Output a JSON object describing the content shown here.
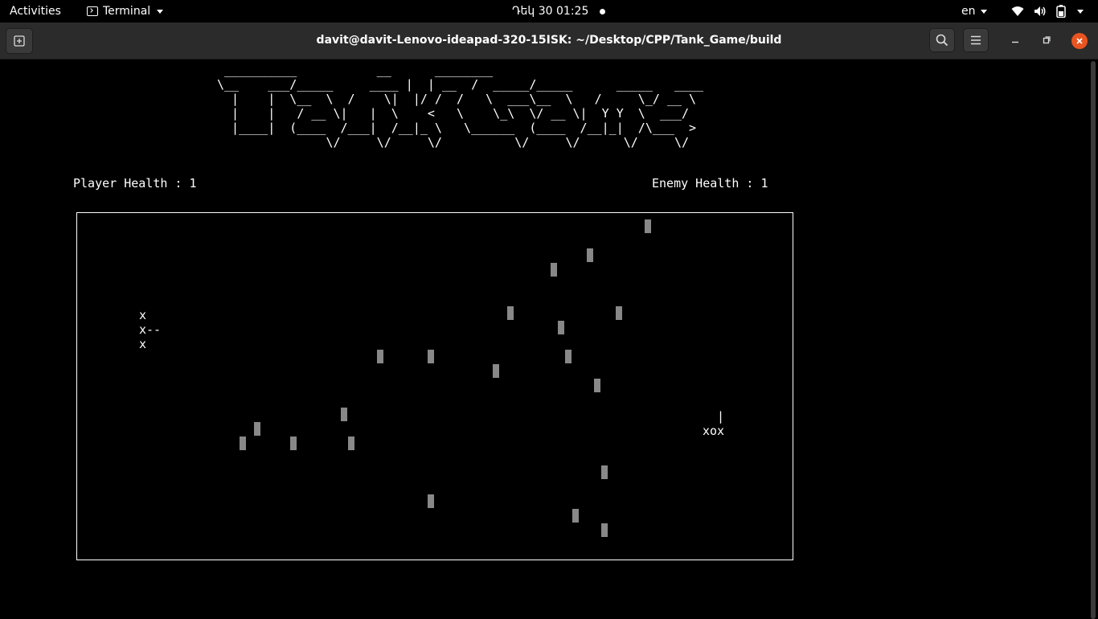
{
  "topbar": {
    "activities": "Activities",
    "app_name": "Terminal",
    "datetime": "Դեկ 30  01:25",
    "language": "en",
    "icons": [
      "wifi-icon",
      "volume-icon",
      "battery-icon",
      "power-menu-caret"
    ]
  },
  "window": {
    "title": "davit@davit-Lenovo-ideapad-320-15ISK: ~/Desktop/CPP/Tank_Game/build",
    "buttons": [
      "new-tab",
      "search",
      "menu",
      "minimize",
      "maximize",
      "close"
    ]
  },
  "colors": {
    "background": "#000000",
    "text": "#ffffff",
    "headerbar": "#2b2b2b",
    "close_button": "#e95420",
    "obstacle": "#888888"
  },
  "game": {
    "title_ascii": " __________           __      ________\n\\__    ___/_____     ____ |  | __  /  _____/_____      _____   ____\n  |    |  \\__  \\  /    \\|  |/ /  /   \\  ___\\__  \\   /     \\_/ __ \\\n  |    |   / __ \\|   |  \\    <   \\    \\_\\  \\/ __ \\|  Y Y  \\  ___/\n  |____|  (____  /___|  /__|_ \\   \\______  (____  /__|_|  /\\___  >\n               \\/     \\/     \\/          \\/     \\/      \\/     \\/",
    "player_health": "Player Health : 1",
    "enemy_health": "Enemy Health : 1",
    "player_tank": "x\nx--\nx",
    "enemy_tank": "  |\nxox",
    "obstacle_count": 22
  }
}
